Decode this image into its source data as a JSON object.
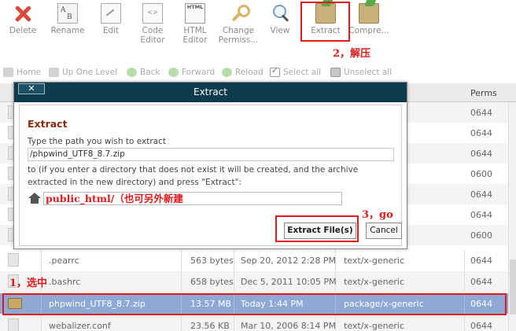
{
  "toolbar": {
    "items": [
      {
        "label": "Delete",
        "icon": "delete-icon"
      },
      {
        "label": "Rename",
        "icon": "rename-icon"
      },
      {
        "label": "Edit",
        "icon": "edit-icon"
      },
      {
        "label": "Code Editor",
        "icon": "code-editor-icon"
      },
      {
        "label": "HTML Editor",
        "icon": "html-editor-icon"
      },
      {
        "label": "Change Permiss...",
        "icon": "key-icon"
      },
      {
        "label": "View",
        "icon": "magnifier-icon"
      },
      {
        "label": "Extract",
        "icon": "extract-icon"
      },
      {
        "label": "Compre...",
        "icon": "compress-icon"
      }
    ],
    "rename_ab": "A\nB",
    "html_tag": "HTML"
  },
  "annotations": {
    "extract": "2，解压",
    "go": "3，go",
    "select": "1，选中"
  },
  "navbar": {
    "home": "Home",
    "up": "Up One Level",
    "back": "Back",
    "forward": "Forward",
    "reload": "Reload",
    "select_all": "Select all",
    "unselect_all": "Unselect all"
  },
  "list": {
    "perms_header": "Perms",
    "rows": [
      {
        "name": "",
        "size": "",
        "date": "",
        "type": "",
        "perms": "0644"
      },
      {
        "name": "",
        "size": "",
        "date": "",
        "type": "",
        "perms": "0644"
      },
      {
        "name": "",
        "size": "",
        "date": "",
        "type": "",
        "perms": "0644"
      },
      {
        "name": "",
        "size": "",
        "date": "",
        "type": "",
        "perms": "0600"
      },
      {
        "name": "",
        "size": "",
        "date": "",
        "type": "",
        "perms": "0644"
      },
      {
        "name": "",
        "size": "",
        "date": "",
        "type": "",
        "perms": "0644"
      },
      {
        "name": "",
        "size": "",
        "date": "",
        "type": "",
        "perms": "0600"
      },
      {
        "name": ".pearrc",
        "size": "563 bytes",
        "date": "Sep 20, 2012 2:28 PM",
        "type": "text/x-generic",
        "perms": "0644"
      },
      {
        "name": ".bashrc",
        "size": "658 bytes",
        "date": "Dec 5, 2011 10:05 PM",
        "type": "text/x-generic",
        "perms": "0644"
      },
      {
        "name": "phpwind_UTF8_8.7.zip",
        "size": "13.57 MB",
        "date": "Today 1:44 PM",
        "type": "package/x-generic",
        "perms": "0644"
      },
      {
        "name": "webalizer.conf",
        "size": "23.56 KB",
        "date": "Mar 10, 2006 8:14 PM",
        "type": "text/x-generic",
        "perms": "0644"
      }
    ]
  },
  "dialog": {
    "title": "Extract",
    "close": "✕",
    "heading": "Extract",
    "prompt": "Type the path you wish to extract",
    "path_value": "/phpwind_UTF8_8.7.zip",
    "note": "to (if you enter a directory that does not exist it will be created, and the archive extracted in the new directory) and press \"Extract\":",
    "dest_value": "public_html/（也可另外新建",
    "extract_button": "Extract File(s)",
    "cancel_button": "Cancel"
  }
}
